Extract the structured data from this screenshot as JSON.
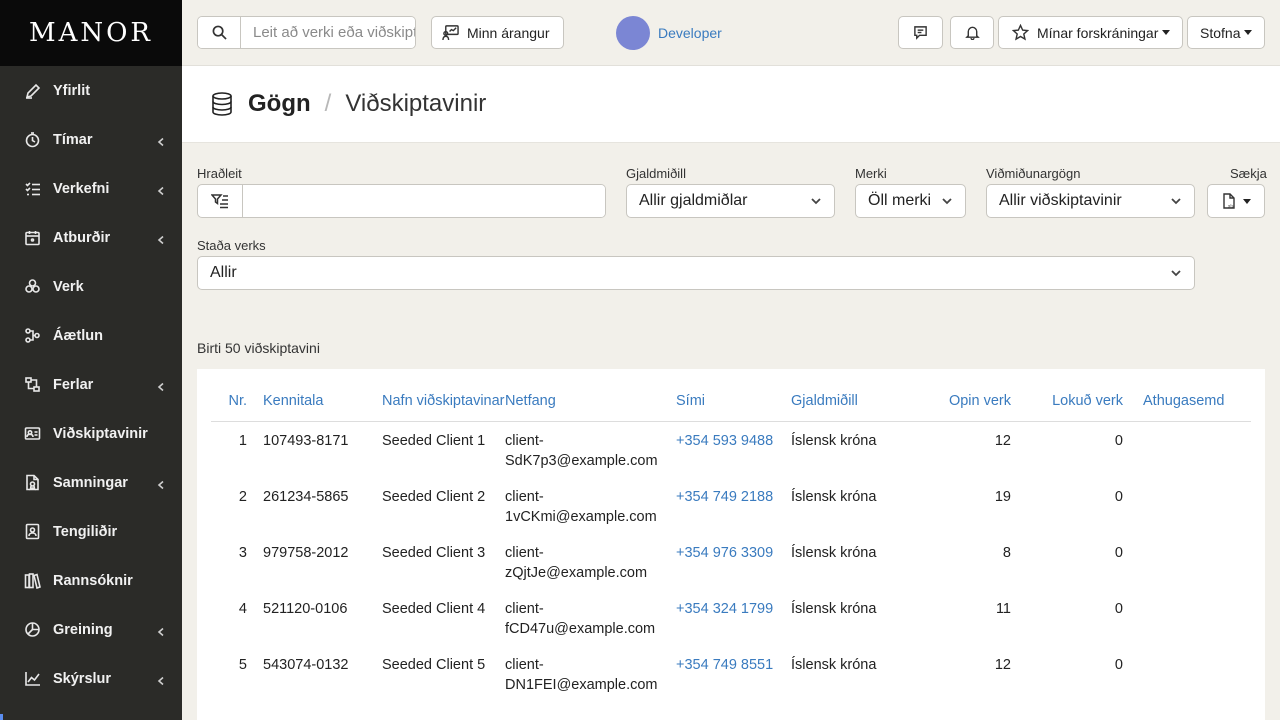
{
  "brand": "MANOR",
  "sidebar": {
    "items": [
      {
        "label": "Yfirlit",
        "icon": "pen-chart-icon",
        "has_submenu": false
      },
      {
        "label": "Tímar",
        "icon": "stopwatch-icon",
        "has_submenu": true
      },
      {
        "label": "Verkefni",
        "icon": "task-list-icon",
        "has_submenu": true
      },
      {
        "label": "Atburðir",
        "icon": "calendar-icon",
        "has_submenu": true
      },
      {
        "label": "Verk",
        "icon": "project-icon",
        "has_submenu": false
      },
      {
        "label": "Áætlun",
        "icon": "plan-icon",
        "has_submenu": false
      },
      {
        "label": "Ferlar",
        "icon": "workflow-icon",
        "has_submenu": true
      },
      {
        "label": "Viðskiptavinir",
        "icon": "clients-icon",
        "has_submenu": false
      },
      {
        "label": "Samningar",
        "icon": "contract-icon",
        "has_submenu": true
      },
      {
        "label": "Tengiliðir",
        "icon": "contact-icon",
        "has_submenu": false
      },
      {
        "label": "Rannsóknir",
        "icon": "books-icon",
        "has_submenu": false
      },
      {
        "label": "Greining",
        "icon": "analysis-icon",
        "has_submenu": true
      },
      {
        "label": "Skýrslur",
        "icon": "line-chart-icon",
        "has_submenu": true
      }
    ]
  },
  "topbar": {
    "search_placeholder": "Leit að verki eða viðskiptavini",
    "performance_label": "Minn árangur",
    "user_name": "Developer",
    "favorites_label": "Mínar forskráningar",
    "create_label": "Stofna"
  },
  "page": {
    "title": "Gögn",
    "separator": "/",
    "subtitle": "Viðskiptavinir"
  },
  "filters": {
    "quick_label": "Hraðleit",
    "quick_value": "",
    "currency_label": "Gjaldmiðill",
    "currency_value": "Allir gjaldmiðlar",
    "tags_label": "Merki",
    "tags_value": "Öll merki",
    "reference_label": "Viðmiðunargögn",
    "reference_value": "Allir viðskiptavinir",
    "download_label": "Sækja",
    "status_label": "Staða verks",
    "status_value": "Allir"
  },
  "results_text": "Birti 50 viðskiptavini",
  "table": {
    "headers": [
      "Nr.",
      "Kennitala",
      "Nafn viðskiptavinar",
      "Netfang",
      "Sími",
      "Gjaldmiðill",
      "Opin verk",
      "Lokuð verk",
      "Athugasemd"
    ],
    "rows": [
      {
        "nr": "1",
        "kennitala": "107493-8171",
        "name": "Seeded Client 1",
        "email": "client-SdK7p3@example.com",
        "phone": "+354 593 9488",
        "currency": "Íslensk króna",
        "open": "12",
        "closed": "0",
        "note": ""
      },
      {
        "nr": "2",
        "kennitala": "261234-5865",
        "name": "Seeded Client 2",
        "email": "client-1vCKmi@example.com",
        "phone": "+354 749 2188",
        "currency": "Íslensk króna",
        "open": "19",
        "closed": "0",
        "note": ""
      },
      {
        "nr": "3",
        "kennitala": "979758-2012",
        "name": "Seeded Client 3",
        "email": "client-zQjtJe@example.com",
        "phone": "+354 976 3309",
        "currency": "Íslensk króna",
        "open": "8",
        "closed": "0",
        "note": ""
      },
      {
        "nr": "4",
        "kennitala": "521120-0106",
        "name": "Seeded Client 4",
        "email": "client-fCD47u@example.com",
        "phone": "+354 324 1799",
        "currency": "Íslensk króna",
        "open": "11",
        "closed": "0",
        "note": ""
      },
      {
        "nr": "5",
        "kennitala": "543074-0132",
        "name": "Seeded Client 5",
        "email": "client-DN1FEI@example.com",
        "phone": "+354 749 8551",
        "currency": "Íslensk króna",
        "open": "12",
        "closed": "0",
        "note": ""
      }
    ]
  },
  "colors": {
    "sidebar_bg": "#2b2b28",
    "brand_bg": "#0a0a0a",
    "link": "#3a7bbf",
    "page_bg": "#f2f0ea",
    "avatar": "#7b86d4"
  }
}
